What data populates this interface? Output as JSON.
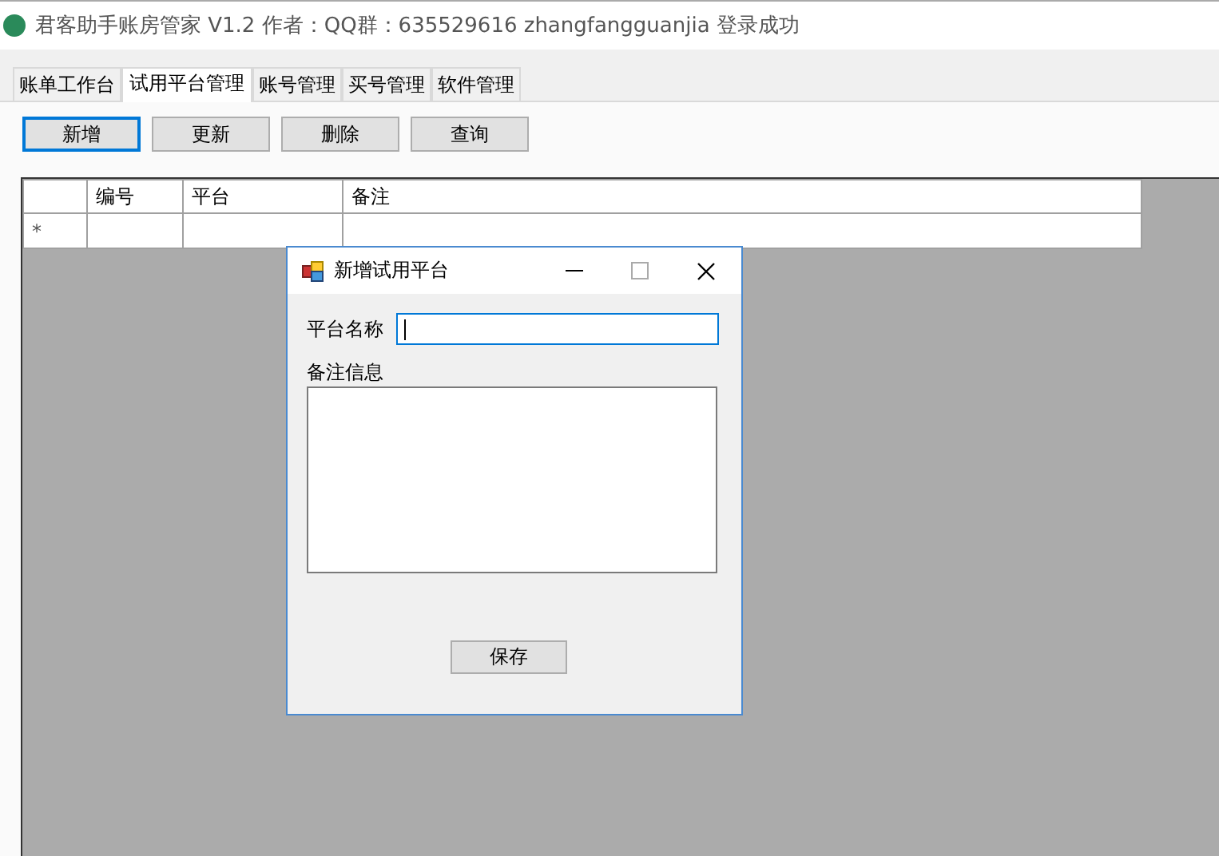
{
  "window": {
    "title": "君客助手账房管家 V1.2 作者：QQ群：635529616 zhangfangguanjia 登录成功"
  },
  "tabs": [
    {
      "label": "账单工作台",
      "selected": false
    },
    {
      "label": "试用平台管理",
      "selected": true
    },
    {
      "label": "账号管理",
      "selected": false
    },
    {
      "label": "买号管理",
      "selected": false
    },
    {
      "label": "软件管理",
      "selected": false
    }
  ],
  "toolbar": [
    {
      "label": "新增",
      "focused": true
    },
    {
      "label": "更新",
      "focused": false
    },
    {
      "label": "删除",
      "focused": false
    },
    {
      "label": "查询",
      "focused": false
    }
  ],
  "table": {
    "columns": [
      "编号",
      "平台",
      "备注"
    ],
    "new_row_marker": "*"
  },
  "dialog": {
    "title": "新增试用平台",
    "name_label": "平台名称",
    "note_label": "备注信息",
    "save_button": "保存"
  }
}
